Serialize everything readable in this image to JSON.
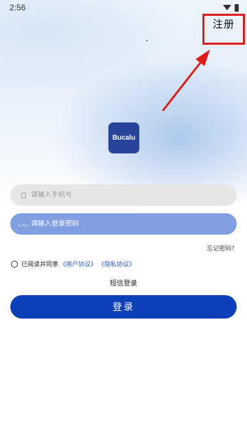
{
  "status_bar": {
    "time": "2:56"
  },
  "header": {
    "register_label": "注册"
  },
  "logo": {
    "text": "Bucalu"
  },
  "form": {
    "phone_placeholder": "请输入手机号",
    "password_placeholder": "请输入登录密码",
    "forgot_password": "忘记密码?"
  },
  "agreement": {
    "prefix": "已阅读并同意",
    "user_agreement": "《用户协议》",
    "privacy_policy": "《隐私协议》"
  },
  "sms_login_label": "短信登录",
  "login_button_label": "登录",
  "annotation_color": "#e11a1a",
  "icons": {
    "phone": "phone-icon",
    "password": "eye-icon",
    "wifi": "wifi-icon",
    "battery": "battery-icon"
  }
}
